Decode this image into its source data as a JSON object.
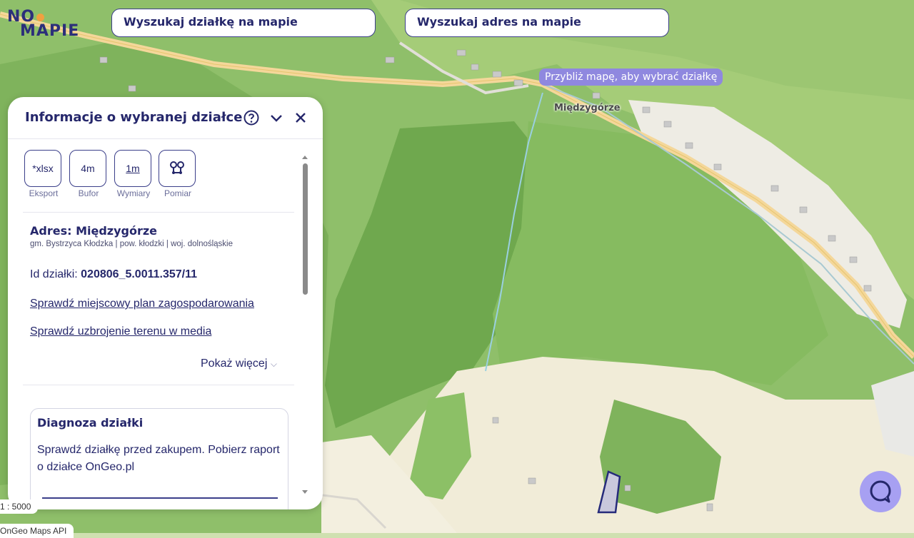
{
  "logo": {
    "line1": "NO",
    "line2": "MAPIE"
  },
  "search": {
    "parcel_placeholder": "Wyszukaj działkę na mapie",
    "address_placeholder": "Wyszukaj adres na mapie"
  },
  "map": {
    "tooltip": "Przybliż mapę, aby wybrać działkę",
    "town_label": "Międzygórze",
    "scale": "1 : 5000",
    "credit": "OnGeo Maps API"
  },
  "panel": {
    "title": "Informacje o wybranej działce",
    "tools": [
      {
        "value": "*xlsx",
        "label": "Eksport"
      },
      {
        "value": "4m",
        "label": "Bufor"
      },
      {
        "value": "1m",
        "label": "Wymiary"
      },
      {
        "value": "",
        "label": "Pomiar",
        "icon": "measure-pins-icon"
      }
    ],
    "address_title": "Adres: Międzygórze",
    "address_sub": "gm. Bystrzyca Kłodzka | pow. kłodzki | woj. dolnośląskie",
    "id_label": "Id działki:",
    "id_value": "020806_5.0011.357/11",
    "link_plan": "Sprawdź miejscowy plan zagospodarowania",
    "link_media": "Sprawdź uzbrojenie terenu w media",
    "show_more": "Pokaż więcej",
    "diag_title": "Diagnoza działki",
    "diag_text": "Sprawdź działkę przed zakupem. Pobierz raport o działce OnGeo.pl"
  },
  "colors": {
    "accent": "#25276b",
    "tooltip": "#8f88df",
    "chat": "#a7a0f2"
  }
}
